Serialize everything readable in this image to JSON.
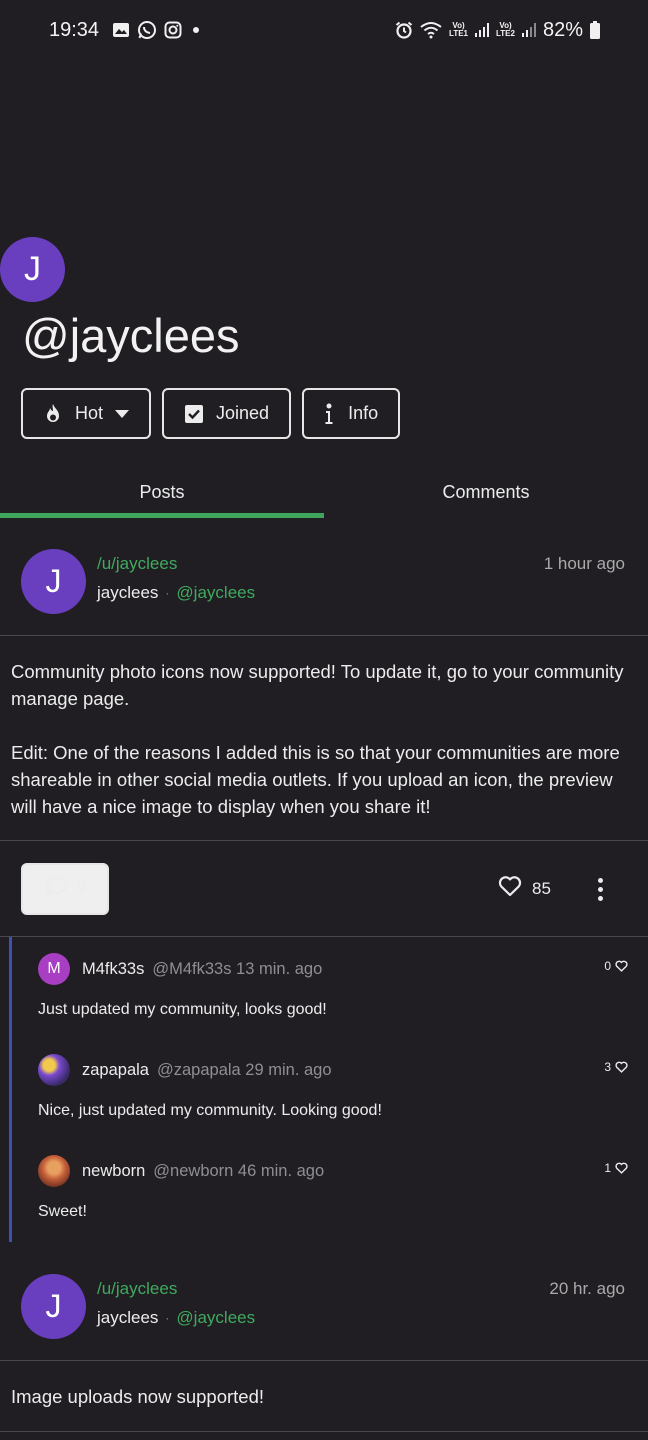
{
  "status_bar": {
    "time": "19:34",
    "signal1": "LTE1",
    "signal2": "LTE2",
    "battery": "82%",
    "icons": [
      "gallery-icon",
      "whatsapp-icon",
      "instagram-icon",
      "alarm-icon",
      "wifi-icon",
      "signal-icon",
      "battery-icon"
    ]
  },
  "community": {
    "avatar_letter": "J",
    "title": "@jayclees",
    "avatar_color": "#6a3fbf"
  },
  "chips": {
    "sort_label": "Hot",
    "joined_label": "Joined",
    "info_label": "Info"
  },
  "tabs": {
    "posts": "Posts",
    "comments": "Comments",
    "active": "Posts",
    "accent": "#3da55d"
  },
  "posts": [
    {
      "avatar_letter": "J",
      "community": "/u/jayclees",
      "author": "jayclees",
      "separator": "·",
      "handle": "@jayclees",
      "time": "1 hour ago",
      "body": [
        "Community photo icons now supported! To update it, go to your community manage page.",
        "Edit: One of the reasons I added this is so that your communities are more shareable in other social media outlets. If you upload an icon, the preview will have a nice image to display when you share it!"
      ],
      "comment_count": "9",
      "like_count": "85",
      "comments": [
        {
          "avatar_letter": "M",
          "avatar_color": "#a83ec2",
          "name": "M4fk33s",
          "meta": "@M4fk33s 13 min. ago",
          "text": "Just updated my community, looks good!",
          "likes": "0"
        },
        {
          "avatar_letter": "",
          "avatar_color": "#7b4bd0",
          "name": "zapapala",
          "meta": "@zapapala 29 min. ago",
          "text": "Nice, just updated my community. Looking good!",
          "likes": "3"
        },
        {
          "avatar_letter": "",
          "avatar_color": "#c5603a",
          "name": "newborn",
          "meta": "@newborn 46 min. ago",
          "text": "Sweet!",
          "likes": "1"
        }
      ]
    },
    {
      "avatar_letter": "J",
      "community": "/u/jayclees",
      "author": "jayclees",
      "separator": "·",
      "handle": "@jayclees",
      "time": "20 hr. ago",
      "body": [
        "Image uploads now supported!"
      ]
    }
  ]
}
